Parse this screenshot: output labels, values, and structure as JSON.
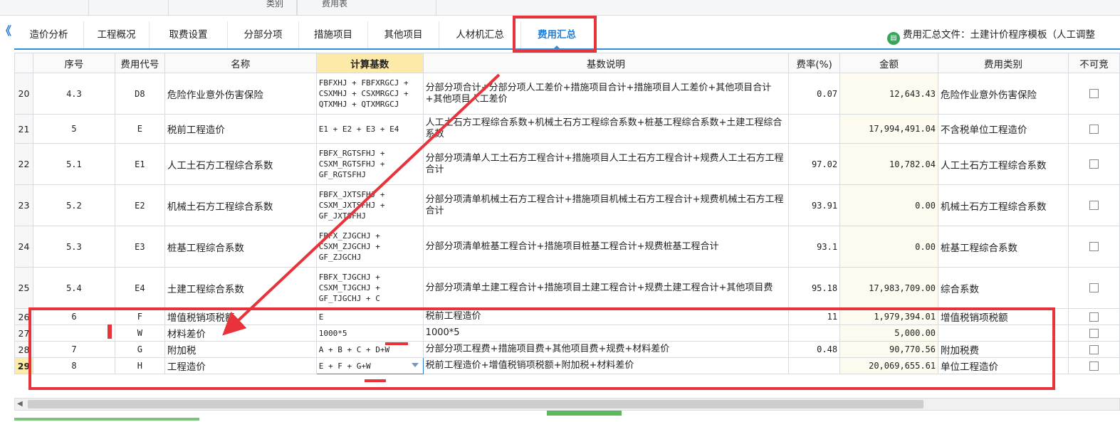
{
  "top_strip": {
    "labels": [
      "类别",
      "费用表"
    ]
  },
  "collapse_glyph": "《",
  "tabs": [
    {
      "label": "造价分析"
    },
    {
      "label": "工程概况"
    },
    {
      "label": "取费设置"
    },
    {
      "label": "分部分项"
    },
    {
      "label": "措施项目"
    },
    {
      "label": "其他项目"
    },
    {
      "label": "人材机汇总"
    },
    {
      "label": "费用汇总",
      "active": true
    }
  ],
  "file_info": {
    "icon": "document-icon",
    "text": "费用汇总文件：土建计价程序模板（人工调整"
  },
  "table": {
    "headers": [
      "",
      "序号",
      "费用代号",
      "名称",
      "计算基数",
      "基数说明",
      "费率(%)",
      "金额",
      "费用类别",
      "不可竞"
    ],
    "rows": [
      {
        "rn": "20",
        "seq": "4.3",
        "code": "D8",
        "name": "危险作业意外伤害保险",
        "base": "FBFXHJ + FBFXRGCJ + CSXMHJ + CSXMRGCJ + QTXMHJ + QTXMRGCJ",
        "desc": "分部分项合计+分部分项人工差价+措施项目合计+措施项目人工差价+其他项目合计+其他项目人工差价",
        "rate": "0.07",
        "amount": "12,643.43",
        "category": "危险作业意外伤害保险"
      },
      {
        "rn": "21",
        "seq": "5",
        "code": "E",
        "name": "税前工程造价",
        "base": "E1 + E2 + E3 + E4",
        "desc": "人工土石方工程综合系数+机械土石方工程综合系数+桩基工程综合系数+土建工程综合系数",
        "rate": "",
        "amount": "17,994,491.04",
        "category": "不含税单位工程造价"
      },
      {
        "rn": "22",
        "seq": "5.1",
        "code": "E1",
        "name": "人工土石方工程综合系数",
        "base": "FBFX_RGTSFHJ + CSXM_RGTSFHJ + GF_RGTSFHJ",
        "desc": "分部分项清单人工土石方工程合计+措施项目人工土石方工程合计+规费人工土石方工程合计",
        "rate": "97.02",
        "amount": "10,782.04",
        "category": "人工土石方工程综合系数"
      },
      {
        "rn": "23",
        "seq": "5.2",
        "code": "E2",
        "name": "机械土石方工程综合系数",
        "base": "FBFX_JXTSFHJ + CSXM_JXTSFHJ + GF_JXTSFHJ",
        "desc": "分部分项清单机械土石方工程合计+措施项目机械土石方工程合计+规费机械土石方工程合计",
        "rate": "93.91",
        "amount": "0.00",
        "category": "机械土石方工程综合系数"
      },
      {
        "rn": "24",
        "seq": "5.3",
        "code": "E3",
        "name": "桩基工程综合系数",
        "base": "FBFX_ZJGCHJ + CSXM_ZJGCHJ + GF_ZJGCHJ",
        "desc": "分部分项清单桩基工程合计+措施项目桩基工程合计+规费桩基工程合计",
        "rate": "93.1",
        "amount": "0.00",
        "category": "桩基工程综合系数"
      },
      {
        "rn": "25",
        "seq": "5.4",
        "code": "E4",
        "name": "土建工程综合系数",
        "base": "FBFX_TJGCHJ + CSXM_TJGCHJ + GF_TJGCHJ + C",
        "desc": "分部分项清单土建工程合计+措施项目土建工程合计+规费土建工程合计+其他项目费",
        "rate": "95.18",
        "amount": "17,983,709.00",
        "category": "综合系数"
      },
      {
        "rn": "26",
        "seq": "6",
        "code": "F",
        "name": "增值税销项税额",
        "base": "E",
        "desc": "税前工程造价",
        "rate": "11",
        "amount": "1,979,394.01",
        "category": "增值税销项税额"
      },
      {
        "rn": "27",
        "seq": "",
        "code": "W",
        "name": "材料差价",
        "base": "1000*5",
        "desc": "1000*5",
        "rate": "",
        "amount": "5,000.00",
        "category": ""
      },
      {
        "rn": "28",
        "seq": "7",
        "code": "G",
        "name": "附加税",
        "base": "A + B + C + D+W",
        "desc": "分部分项工程费+措施项目费+其他项目费+规费+材料差价",
        "rate": "0.48",
        "amount": "90,770.56",
        "category": "附加税费"
      },
      {
        "rn": "29",
        "seq": "8",
        "code": "H",
        "name": "工程造价",
        "base": "E + F + G+W",
        "desc": "税前工程造价+增值税销项税额+附加税+材料差价",
        "rate": "",
        "amount": "20,069,655.61",
        "category": "单位工程造价",
        "current": true
      }
    ]
  },
  "annotation_color": "#e8333a"
}
